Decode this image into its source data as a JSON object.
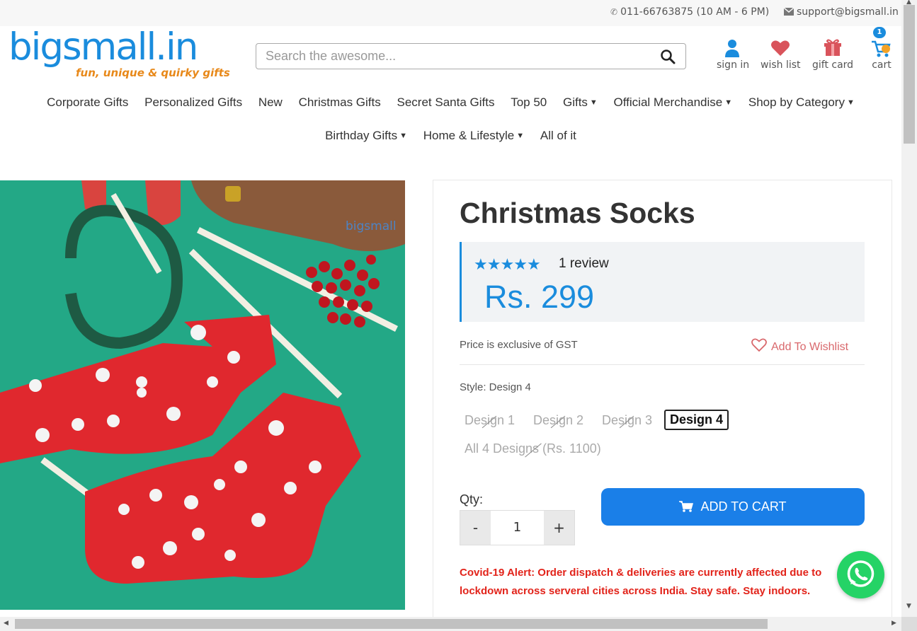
{
  "topbar": {
    "phone": "011-66763875 (10 AM - 6 PM)",
    "email": "support@bigsmall.in",
    "phone_icon": "phone-icon",
    "email_icon": "envelope-icon"
  },
  "logo": {
    "text": "bigsmall.in",
    "tagline": "fun, unique & quirky gifts"
  },
  "search": {
    "placeholder": "Search the awesome...",
    "value": ""
  },
  "header_icons": {
    "signin": "sign in",
    "wishlist": "wish list",
    "giftcard": "gift card",
    "cart": "cart",
    "cart_count": "1"
  },
  "nav": {
    "row1": [
      "Corporate Gifts",
      "Personalized Gifts",
      "New",
      "Christmas Gifts",
      "Secret Santa Gifts",
      "Top 50",
      "Gifts",
      "Official Merchandise",
      "Shop by Category"
    ],
    "row2": [
      "Birthday Gifts",
      "Home & Lifestyle",
      "All of it"
    ]
  },
  "product": {
    "title": "Christmas Socks",
    "rating": 5,
    "reviews": "1 review",
    "price": "Rs. 299",
    "gst_note": "Price is exclusive of GST",
    "wishlist_label": "Add To Wishlist",
    "style_label": "Style: Design 4",
    "options": [
      "Design 1",
      "Design 2",
      "Design 3",
      "Design 4",
      "All 4 Designs (Rs. 1100)"
    ],
    "selected_option": "Design 4",
    "qty_label": "Qty:",
    "qty_minus": "-",
    "qty_value": "1",
    "qty_plus": "+",
    "add_to_cart": "ADD TO CART",
    "covid_alert": "Covid-19 Alert: Order dispatch & deliveries are currently affected due to lockdown across serveral cities across India. Stay safe. Stay indoors."
  },
  "colors": {
    "brand_blue": "#1a8cdd",
    "button_blue": "#1a7fe8",
    "alert_red": "#e2231a",
    "wishlist_pink": "#d9686c",
    "whatsapp_green": "#25d366"
  }
}
